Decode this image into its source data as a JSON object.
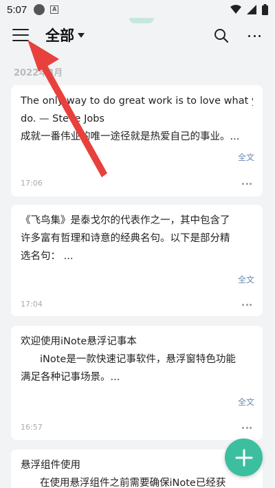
{
  "status_bar": {
    "time": "5:07"
  },
  "app_bar": {
    "title": "全部"
  },
  "month_header": "2022年3月",
  "notes": [
    {
      "lines": [
        "The only way to do great work is to love what you",
        "do. — Steve Jobs",
        "成就一番伟业的唯一途径就是热爱自己的事业。..."
      ],
      "full_label": "全文",
      "time": "17:06"
    },
    {
      "lines": [
        "《飞鸟集》是泰戈尔的代表作之一，其中包含了",
        "许多富有哲理和诗意的经典名句。以下是部分精",
        "选名句： ..."
      ],
      "full_label": "全文",
      "time": "17:04"
    },
    {
      "lines": [
        "欢迎使用iNote悬浮记事本",
        "iNote是一款快速记事软件，悬浮窗特色功能",
        "满足各种记事场景。..."
      ],
      "full_label": "全文",
      "time": "16:57"
    },
    {
      "lines": [
        "悬浮组件使用",
        "在使用悬浮组件之前需要确保iNote已经获"
      ]
    }
  ],
  "colors": {
    "accent": "#3cbf9f",
    "arrow": "#e8413d",
    "background": "#f2f3f5"
  },
  "icons": [
    "menu-icon",
    "caret-down-icon",
    "search-icon",
    "more-icon",
    "plus-icon"
  ]
}
